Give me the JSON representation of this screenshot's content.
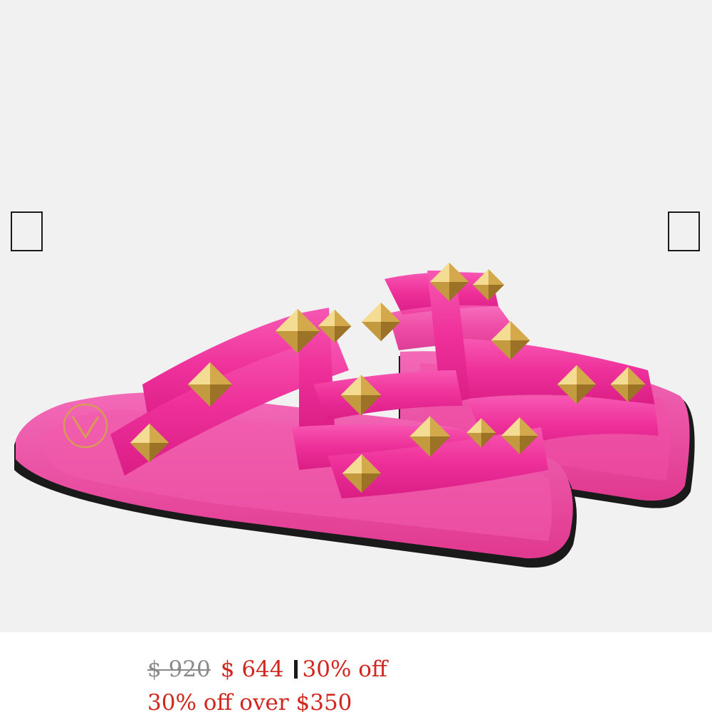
{
  "gallery": {
    "image_alt": "Pink studded flat slide sandals",
    "prev_icon": "empty-square-icon",
    "next_icon": "empty-square-icon"
  },
  "product": {
    "original_price": "$ 920",
    "sale_price": "$ 644",
    "discount": "30% off",
    "promo": "30% off over $350"
  },
  "colors": {
    "background": "#f1f1f1",
    "sale": "#d0261d",
    "strike": "#8a8a8a",
    "sandal_pink": "#ee2f9a",
    "stud_gold": "#c9a445"
  }
}
